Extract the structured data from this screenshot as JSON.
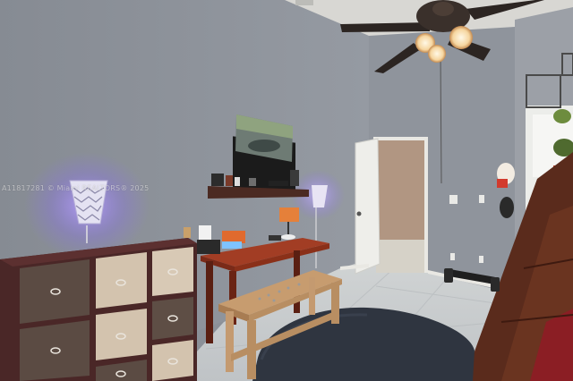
{
  "photo": {
    "watermark_text": "A11817281 © Miami REALTORS® 2025"
  },
  "colors": {
    "wall": "#8e939c",
    "ceiling": "#d7d6d2",
    "floor_tile": "#c9cdd0",
    "rug": "#2f3640",
    "cabinet_frame": "#4a2727",
    "bin_dark": "#5a4a42",
    "bin_light": "#d0c1ad",
    "desk_top": "#9a3a24",
    "bench": "#c9a27a",
    "lamp_glow": "#9b7dff",
    "staircase": "#5a2a1a"
  }
}
